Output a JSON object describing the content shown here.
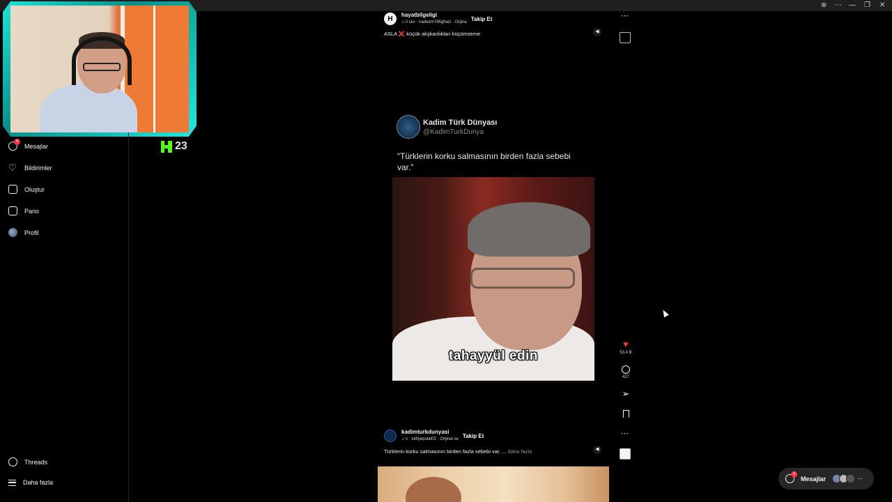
{
  "browser": {
    "controls": [
      "⊕",
      "⋯",
      "—",
      "❐",
      "✕"
    ]
  },
  "stream": {
    "kick_count": "23"
  },
  "sidebar": {
    "items": [
      {
        "label": "Mesajlar",
        "icon": "messenger-icon",
        "badge": "4"
      },
      {
        "label": "Bildirimler",
        "icon": "heart-icon"
      },
      {
        "label": "Oluştur",
        "icon": "plus-square-icon"
      },
      {
        "label": "Pano",
        "icon": "dashboard-icon"
      },
      {
        "label": "Profil",
        "icon": "avatar-icon"
      }
    ],
    "threads_label": "Threads",
    "more_label": "Daha fazla"
  },
  "posts": [
    {
      "username": "hayatbilgeligi",
      "audio": "♫ il ses · nadeem786ghazi · Orijina",
      "follow": "Takip Et",
      "caption": "ASLA ❌ küçük alışkanlıkları küçümseme",
      "avatar_letter": "H"
    },
    {
      "username": "kadimturkdunyasi",
      "audio": "♫ s · lutfiyepolat03 · Orijinal se",
      "follow": "Takip Et",
      "caption": "Türklerin korku salmasının birden fazla sebebi var. ...",
      "caption_more": "daha fazla"
    }
  ],
  "reel": {
    "tweet_name": "Kadim Türk Dünyası",
    "tweet_handle": "@KadimTurkDunya",
    "tweet_text": "“Türklerin korku salmasının birden fazla sebebi var.”",
    "subtitle": "tahayyül edin"
  },
  "actions": {
    "like_count": "53,4 B",
    "comment_count": "427"
  },
  "messages_pill": {
    "label": "Mesajlar",
    "badge": "4"
  },
  "colors": {
    "accent_red": "#ff3040",
    "kick_green": "#53fc18",
    "webcam_frame": "#1ee3d8"
  }
}
